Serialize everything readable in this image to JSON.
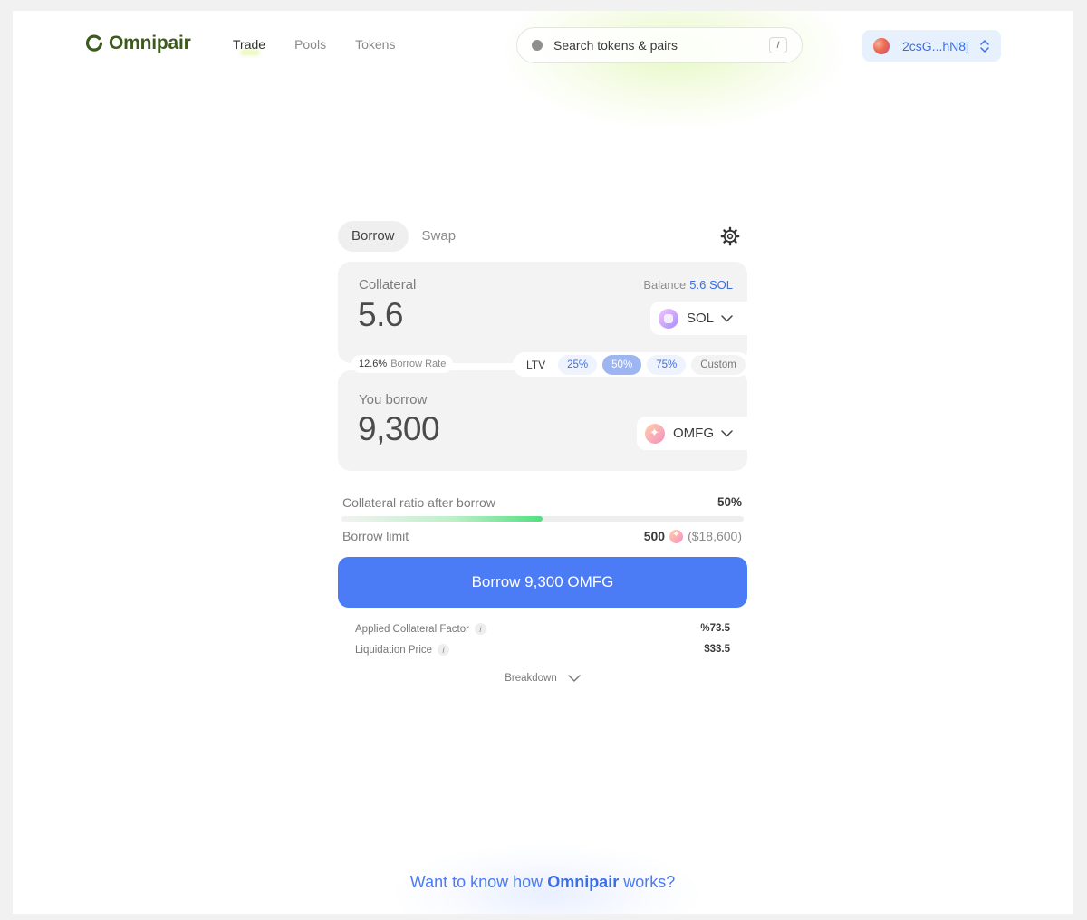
{
  "header": {
    "logo_text": "Omnipair",
    "nav": [
      {
        "label": "Trade",
        "active": true
      },
      {
        "label": "Pools",
        "active": false
      },
      {
        "label": "Tokens",
        "active": false
      }
    ],
    "search": {
      "placeholder": "Search tokens & pairs",
      "shortcut": "/"
    },
    "wallet": {
      "address": "2csG...hN8j"
    }
  },
  "card": {
    "tabs": [
      {
        "label": "Borrow",
        "active": true
      },
      {
        "label": "Swap",
        "active": false
      }
    ],
    "collateral": {
      "label": "Collateral",
      "amount": "5.6",
      "balance_label": "Balance",
      "balance_value": "5.6 SOL",
      "token": "SOL"
    },
    "borrow_rate": {
      "value": "12.6%",
      "label": "Borrow Rate"
    },
    "ltv": {
      "label": "LTV",
      "options": [
        "25%",
        "50%",
        "75%",
        "Custom"
      ],
      "selected": "50%"
    },
    "borrow": {
      "label": "You borrow",
      "amount": "9,300",
      "token": "OMFG"
    },
    "collateral_ratio": {
      "label": "Collateral ratio after borrow",
      "value": "50%",
      "fill_fraction": 0.5
    },
    "borrow_limit": {
      "label": "Borrow limit",
      "amount": "500",
      "usd": "($18,600)"
    },
    "cta_label": "Borrow 9,300 OMFG",
    "details": [
      {
        "label": "Applied Collateral Factor",
        "value": "%73.5"
      },
      {
        "label": "Liquidation Price",
        "value": "$33.5"
      }
    ],
    "breakdown_label": "Breakdown"
  },
  "footer": {
    "prefix": "Want to know how",
    "brand": "Omnipair",
    "suffix": "works?"
  },
  "colors": {
    "accent": "#4c7bf6",
    "logo": "#3d5a1e",
    "progress": "#4fe07f"
  },
  "icons": [
    "logo-icon",
    "search-icon",
    "wallet-avatar-icon",
    "chevron-updown-icon",
    "gear-icon",
    "sol-token-icon",
    "chevron-down-icon",
    "omfg-token-icon",
    "info-icon"
  ]
}
